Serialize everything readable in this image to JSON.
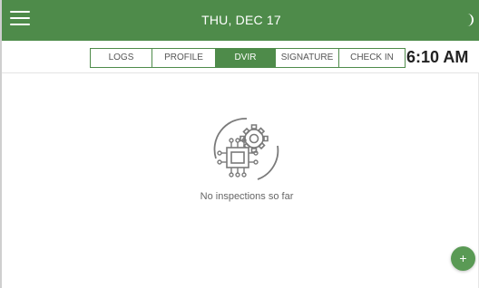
{
  "header": {
    "title": "THU, DEC 17",
    "menu_icon": "hamburger-menu-icon",
    "theme_icon": "moon-icon",
    "color": "#4e8b4a"
  },
  "tabs": [
    {
      "label": "LOGS",
      "active": false
    },
    {
      "label": "PROFILE",
      "active": false
    },
    {
      "label": "DVIR",
      "active": true
    },
    {
      "label": "SIGNATURE",
      "active": false
    },
    {
      "label": "CHECK IN",
      "active": false
    }
  ],
  "clock": {
    "time": "6:10 AM"
  },
  "empty_state": {
    "icon": "chip-gear-icon",
    "message": "No inspections so far"
  },
  "fab": {
    "label": "+",
    "icon": "add-icon",
    "color": "#5a9a55"
  }
}
